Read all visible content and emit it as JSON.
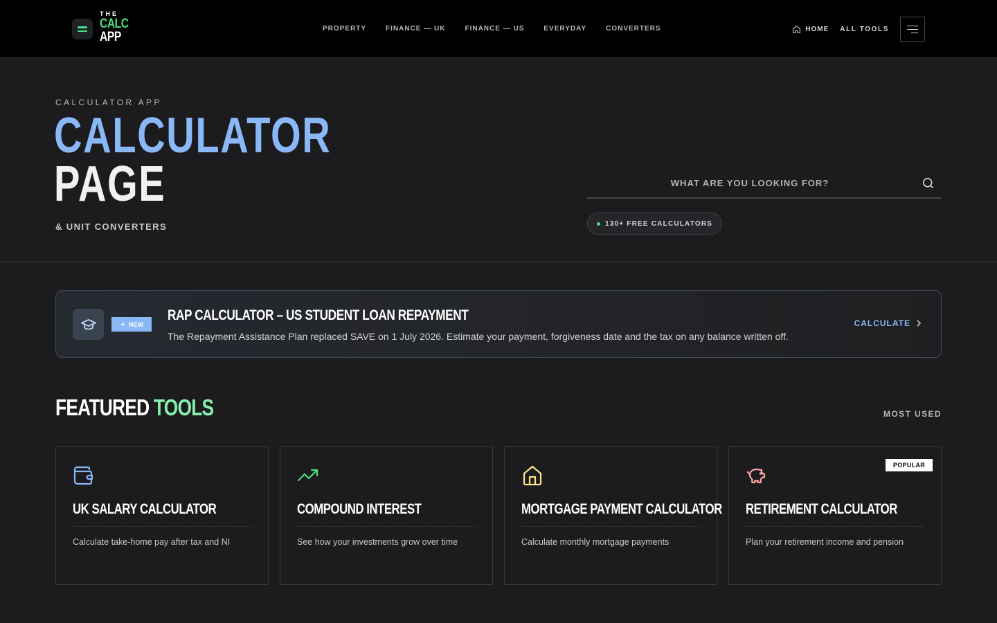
{
  "brand": {
    "the": "THE",
    "calc": "CALC",
    "app": "APP"
  },
  "nav": {
    "links": [
      "PROPERTY",
      "FINANCE — UK",
      "FINANCE — US",
      "EVERYDAY",
      "CONVERTERS"
    ],
    "home": "HOME",
    "all_tools": "ALL TOOLS"
  },
  "hero": {
    "eyebrow": "CALCULATOR APP",
    "title_line1": "CALCULATOR",
    "title_line2": "PAGE",
    "subtitle": "& UNIT CONVERTERS",
    "search_placeholder": "WHAT ARE YOU LOOKING FOR?",
    "pill": "130+ FREE CALCULATORS"
  },
  "banner": {
    "badge": "NEW",
    "title": "RAP CALCULATOR – US STUDENT LOAN REPAYMENT",
    "description": "The Repayment Assistance Plan replaced SAVE on 1 July 2026. Estimate your payment, forgiveness date and the tax on any balance written off.",
    "cta": "CALCULATE"
  },
  "featured": {
    "title_main": "FEATURED",
    "title_accent": "TOOLS",
    "most_used": "MOST USED",
    "cards": [
      {
        "icon": "wallet-icon",
        "color": "#8ab8f7",
        "title": "UK SALARY CALCULATOR",
        "desc": "Calculate take-home pay after tax and NI"
      },
      {
        "icon": "trending-up-icon",
        "color": "#4ade80",
        "title": "COMPOUND INTEREST",
        "desc": "See how your investments grow over time"
      },
      {
        "icon": "home-icon",
        "color": "#fde68a",
        "title": "MORTGAGE PAYMENT CALCULATOR",
        "desc": "Calculate monthly mortgage payments"
      },
      {
        "icon": "piggy-bank-icon",
        "color": "#fca5a5",
        "title": "RETIREMENT CALCULATOR",
        "desc": "Plan your retirement income and pension",
        "badge": "POPULAR"
      }
    ]
  }
}
